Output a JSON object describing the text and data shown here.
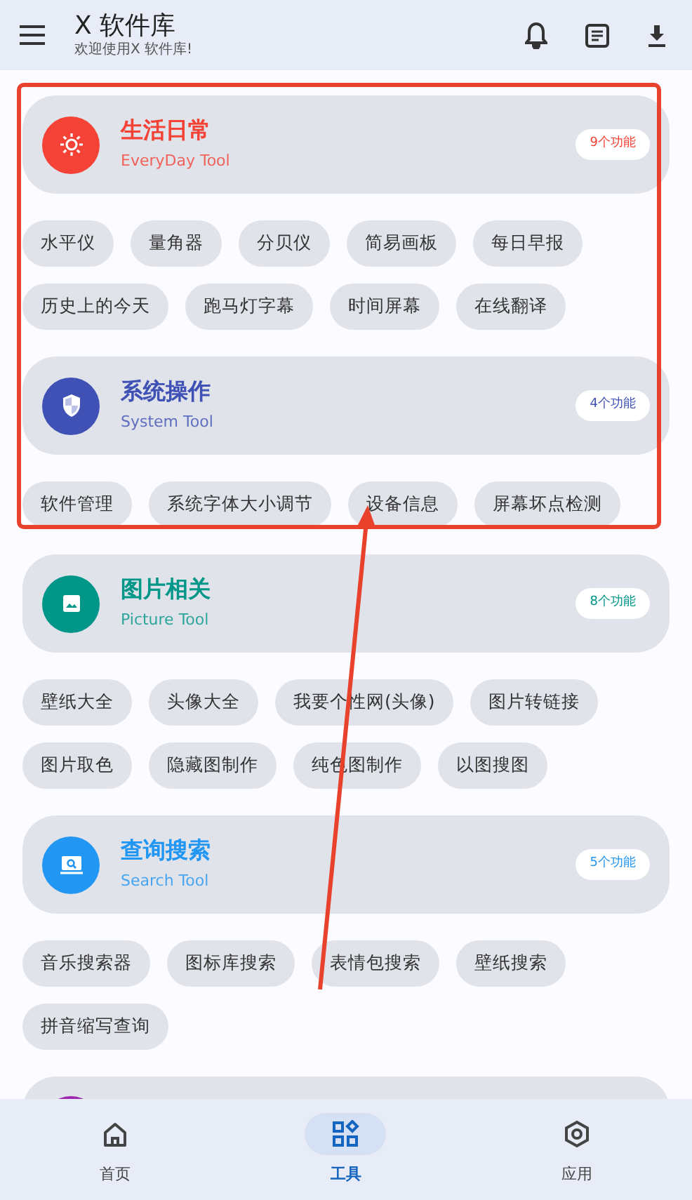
{
  "app_bar": {
    "title": "X 软件库",
    "subtitle": "欢迎使用X 软件库!"
  },
  "categories": [
    {
      "title": "生活日常",
      "subtitle": "EveryDay Tool",
      "count": "9个功能",
      "color": "#f44336",
      "tools": [
        "水平仪",
        "量角器",
        "分贝仪",
        "简易画板",
        "每日早报",
        "历史上的今天",
        "跑马灯字幕",
        "时间屏幕",
        "在线翻译"
      ]
    },
    {
      "title": "系统操作",
      "subtitle": "System Tool",
      "count": "4个功能",
      "color": "#3f51b5",
      "tools": [
        "软件管理",
        "系统字体大小调节",
        "设备信息",
        "屏幕坏点检测"
      ]
    },
    {
      "title": "图片相关",
      "subtitle": "Picture Tool",
      "count": "8个功能",
      "color": "#009688",
      "tools": [
        "壁纸大全",
        "头像大全",
        "我要个性网(头像)",
        "图片转链接",
        "图片取色",
        "隐藏图制作",
        "纯色图制作",
        "以图搜图"
      ]
    },
    {
      "title": "查询搜索",
      "subtitle": "Search Tool",
      "count": "5个功能",
      "color": "#2196f3",
      "tools": [
        "音乐搜索器",
        "图标库搜索",
        "表情包搜索",
        "壁纸搜索",
        "拼音缩写查询"
      ]
    },
    {
      "color": "#9c27b0"
    }
  ],
  "bottom_nav": [
    {
      "label": "首页",
      "selected": false
    },
    {
      "label": "工具",
      "selected": true
    },
    {
      "label": "应用",
      "selected": false
    }
  ]
}
